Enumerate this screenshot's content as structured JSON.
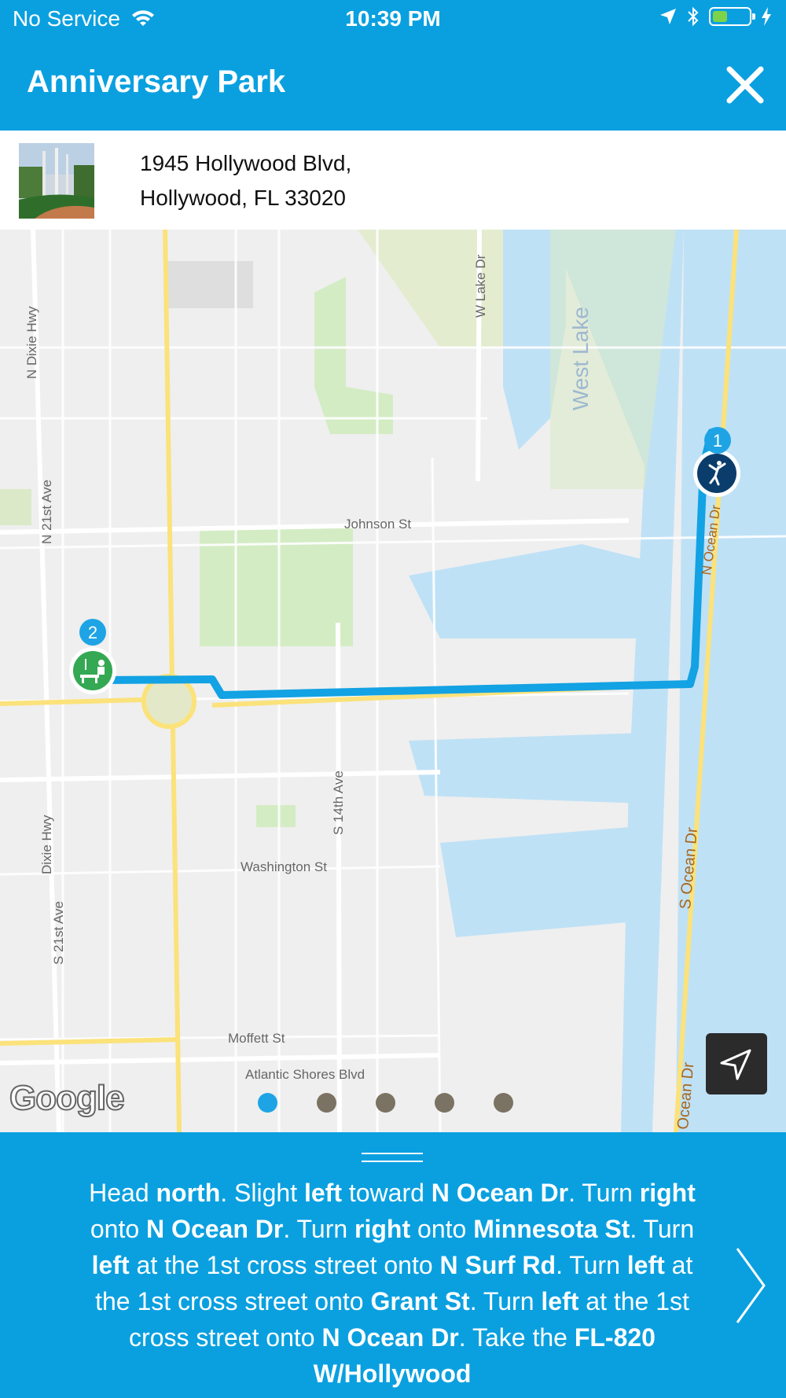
{
  "status": {
    "carrier": "No Service",
    "time": "10:39 PM"
  },
  "header": {
    "title": "Anniversary Park"
  },
  "place": {
    "address_line1": "1945 Hollywood Blvd,",
    "address_line2": "Hollywood, FL 33020"
  },
  "map": {
    "streets": {
      "n_dixie_hwy": "N Dixie Hwy",
      "n_21st_ave": "N 21st Ave",
      "w_lake_dr": "W Lake Dr",
      "west_lake": "West Lake",
      "johnson_st": "Johnson St",
      "n_ocean_dr": "N Ocean Dr",
      "s_14th_ave": "S 14th Ave",
      "dixie_hwy": "Dixie Hwy",
      "washington_st": "Washington St",
      "s_ocean_dr": "S Ocean Dr",
      "s_21st_ave": "S 21st Ave",
      "moffett_st": "Moffett St",
      "atlantic_shores_blvd": "Atlantic Shores Blvd",
      "ocean_dr": "Ocean Dr"
    },
    "markers": [
      {
        "number": "1",
        "icon": "golf-icon",
        "color": "#0a3d6b"
      },
      {
        "number": "2",
        "icon": "park-icon",
        "color": "#34a853"
      }
    ],
    "attribution": "Google",
    "route_color": "#13a2e3"
  },
  "pager": {
    "count": 5,
    "active_index": 0
  },
  "directions": {
    "t1": "Head ",
    "b1": "north",
    "t2": ". Slight ",
    "b2": "left",
    "t3": " toward ",
    "b3": "N Ocean Dr",
    "t4": ". Turn ",
    "b4": "right",
    "t5": " onto ",
    "b5": "N Ocean Dr",
    "t6": ". Turn ",
    "b6": "right",
    "t7": " onto ",
    "b7": "Minnesota St",
    "t8": ". Turn ",
    "b8": "left",
    "t9": " at the 1st cross street onto ",
    "b9": "N Surf Rd",
    "t10": ". Turn ",
    "b10": "left",
    "t11": " at the 1st cross street onto ",
    "b11": "Grant St",
    "t12": ". Turn ",
    "b12": "left",
    "t13": " at the 1st cross street onto ",
    "b13": "N Ocean Dr",
    "t14": ". Take the ",
    "b14": "FL-820 W/Hollywood"
  },
  "colors": {
    "accent": "#0aa0e0"
  }
}
